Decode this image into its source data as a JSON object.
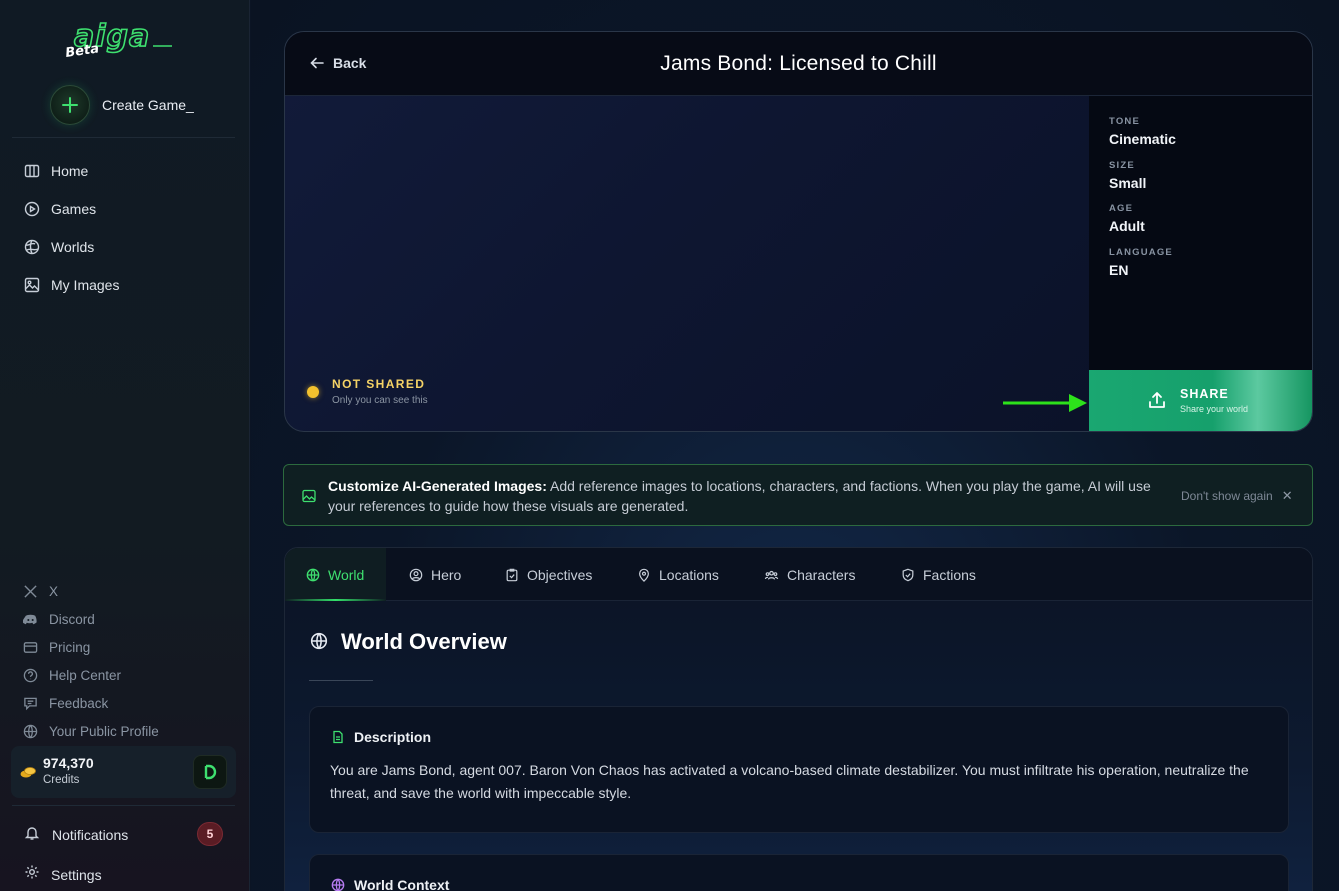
{
  "app": {
    "logo_text": "aiga_",
    "beta_label": "Beta"
  },
  "sidebar": {
    "create_label": "Create Game_",
    "nav": [
      {
        "label": "Home",
        "icon": "columns-icon"
      },
      {
        "label": "Games",
        "icon": "play-circle-icon"
      },
      {
        "label": "Worlds",
        "icon": "globe-icon"
      },
      {
        "label": "My Images",
        "icon": "image-icon"
      }
    ],
    "links": [
      {
        "label": "X",
        "icon": "x-logo-icon"
      },
      {
        "label": "Discord",
        "icon": "discord-icon"
      },
      {
        "label": "Pricing",
        "icon": "credit-card-icon"
      },
      {
        "label": "Help Center",
        "icon": "help-circle-icon"
      },
      {
        "label": "Feedback",
        "icon": "feedback-icon"
      },
      {
        "label": "Your Public Profile",
        "icon": "globe-icon"
      }
    ],
    "credits": {
      "amount": "974,370",
      "label": "Credits"
    },
    "notifications": {
      "label": "Notifications",
      "count": "5"
    },
    "settings_label": "Settings"
  },
  "world": {
    "back_label": "Back",
    "title": "Jams Bond: Licensed to Chill",
    "meta": [
      {
        "key": "TONE",
        "value": "Cinematic"
      },
      {
        "key": "SIZE",
        "value": "Small"
      },
      {
        "key": "AGE",
        "value": "Adult"
      },
      {
        "key": "LANGUAGE",
        "value": "EN"
      }
    ],
    "status": {
      "title": "NOT SHARED",
      "subtitle": "Only you can see this",
      "color": "#f3c12e"
    },
    "share": {
      "title": "SHARE",
      "subtitle": "Share your world",
      "color": "#1aa771"
    }
  },
  "tip": {
    "bold": "Customize AI-Generated Images:",
    "text": " Add reference images to locations, characters, and factions. When you play the game, AI will use your references to guide how these visuals are generated.",
    "dismiss_label": "Don't show again"
  },
  "tabs": [
    {
      "label": "World",
      "icon": "globe-icon",
      "active": true
    },
    {
      "label": "Hero",
      "icon": "user-circle-icon"
    },
    {
      "label": "Objectives",
      "icon": "clipboard-check-icon"
    },
    {
      "label": "Locations",
      "icon": "map-pin-icon"
    },
    {
      "label": "Characters",
      "icon": "users-icon"
    },
    {
      "label": "Factions",
      "icon": "shield-icon"
    }
  ],
  "overview": {
    "title": "World Overview",
    "description_label": "Description",
    "description_text": "You are Jams Bond, agent 007. Baron Von Chaos has activated a volcano-based climate destabilizer. You must infiltrate his operation, neutralize the threat, and save the world with impeccable style.",
    "context_label": "World Context"
  },
  "colors": {
    "accent": "#3ee06f",
    "background": "#0b1424"
  }
}
